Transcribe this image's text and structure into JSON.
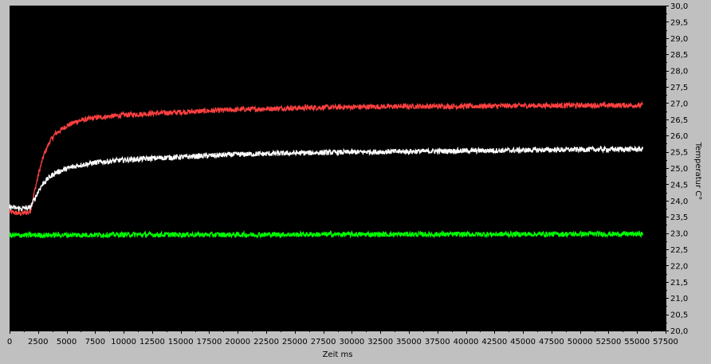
{
  "chart_data": {
    "type": "line",
    "title": "",
    "xlabel": "Zeit ms",
    "ylabel": "Temperatur C°",
    "xlim": [
      0,
      57500
    ],
    "ylim": [
      20.0,
      30.0
    ],
    "x_ticks": [
      0,
      2500,
      5000,
      7500,
      10000,
      12500,
      15000,
      17500,
      20000,
      22500,
      25000,
      27500,
      30000,
      32500,
      35000,
      37500,
      40000,
      42500,
      45000,
      47500,
      50000,
      52500,
      55000,
      57500
    ],
    "x_tick_labels": [
      "0",
      "2500",
      "5000",
      "7500",
      "10000",
      "12500",
      "15000",
      "17500",
      "20000",
      "22500",
      "25000",
      "27500",
      "30000",
      "32500",
      "35000",
      "37500",
      "40000",
      "42500",
      "45000",
      "47500",
      "50000",
      "52500",
      "55000",
      "57500"
    ],
    "y_ticks": [
      20.0,
      20.5,
      21.0,
      21.5,
      22.0,
      22.5,
      23.0,
      23.5,
      24.0,
      24.5,
      25.0,
      25.5,
      26.0,
      26.5,
      27.0,
      27.5,
      28.0,
      28.5,
      29.0,
      29.5,
      30.0
    ],
    "y_tick_labels": [
      "20,0",
      "20,5",
      "21,0",
      "21,5",
      "22,0",
      "22,5",
      "23,0",
      "23,5",
      "24,0",
      "24,5",
      "25,0",
      "25,5",
      "26,0",
      "26,5",
      "27,0",
      "27,5",
      "28,0",
      "28,5",
      "29,0",
      "29,5",
      "30,0"
    ],
    "y_axis_side": "right",
    "grid": false,
    "legend": "none",
    "background": "#000000",
    "series": [
      {
        "color": "#ff4040",
        "x": [
          0,
          1000,
          1800,
          2200,
          2600,
          3000,
          3500,
          4000,
          5000,
          6000,
          7500,
          10000,
          12500,
          15000,
          20000,
          25000,
          30000,
          35000,
          40000,
          45000,
          50000,
          55500
        ],
        "y": [
          23.65,
          23.6,
          23.65,
          24.3,
          24.9,
          25.4,
          25.8,
          26.05,
          26.3,
          26.45,
          26.55,
          26.63,
          26.68,
          26.72,
          26.8,
          26.85,
          26.88,
          26.9,
          26.9,
          26.92,
          26.93,
          26.93
        ]
      },
      {
        "color": "#ffffff",
        "x": [
          0,
          1000,
          1800,
          2200,
          2600,
          3000,
          3500,
          4000,
          5000,
          6000,
          7500,
          10000,
          12500,
          15000,
          20000,
          25000,
          30000,
          35000,
          40000,
          45000,
          50000,
          55500
        ],
        "y": [
          23.8,
          23.75,
          23.78,
          24.05,
          24.35,
          24.55,
          24.72,
          24.85,
          24.98,
          25.08,
          25.17,
          25.25,
          25.3,
          25.34,
          25.42,
          25.46,
          25.49,
          25.51,
          25.53,
          25.55,
          25.57,
          25.58
        ]
      },
      {
        "color": "#00ff00",
        "x": [
          0,
          10000,
          20000,
          30000,
          40000,
          50000,
          55500
        ],
        "y": [
          22.93,
          22.95,
          22.95,
          22.96,
          22.96,
          22.97,
          22.97
        ]
      }
    ]
  }
}
